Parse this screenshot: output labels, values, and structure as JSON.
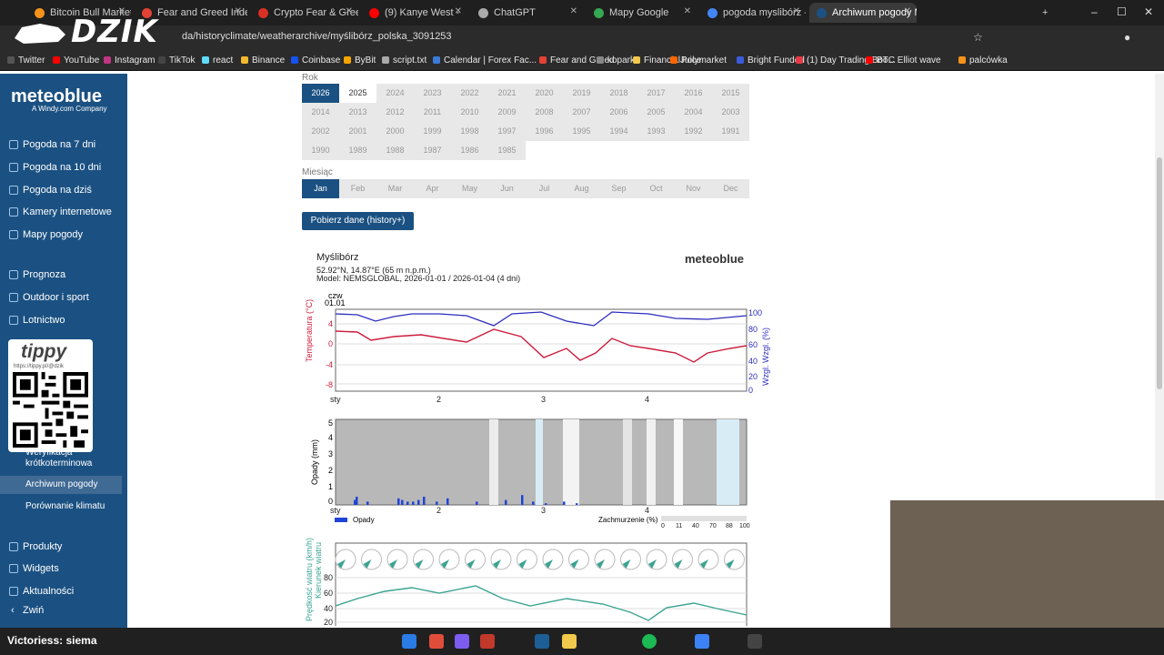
{
  "browser": {
    "tabs": [
      {
        "title": "Bitcoin Bull Market",
        "color": "#f7931a"
      },
      {
        "title": "Fear and Greed Index",
        "color": "#e34234"
      },
      {
        "title": "Crypto Fear & Greed",
        "color": "#d93025"
      },
      {
        "title": "(9) Kanye West -",
        "color": "#ff0000"
      },
      {
        "title": "ChatGPT",
        "color": "#aaaaaa"
      },
      {
        "title": "Mapy Google",
        "color": "#34a853"
      },
      {
        "title": "pogoda myslibórz - S",
        "color": "#4285f4"
      },
      {
        "title": "Archiwum pogody M",
        "color": "#1b5182"
      }
    ],
    "new_tab": "+",
    "url": "da/historyclimate/weatherarchive/myślibórz_polska_3091253",
    "bookmarks": [
      "Twitter",
      "YouTube",
      "Instagram",
      "TikTok",
      "react",
      "Binance",
      "Coinbase",
      "ByBit",
      "script.txt",
      "Calendar | Forex Fac...",
      "Fear and Greed",
      "koparka",
      "FinancialJuice",
      "Polymarket",
      "Bright Funded",
      "(1) Day Trading Boo...",
      "BTC Elliot wave",
      "palcówka"
    ]
  },
  "overlay": {
    "logo": "DZIK",
    "chat_user": "Victoriess",
    "chat_text": ": siema"
  },
  "sidebar": {
    "logo": "meteoblue",
    "logo_sub": "A Windy.com Company",
    "items": [
      "Pogoda na 7 dni",
      "Pogoda na 10 dni",
      "Pogoda na dziś",
      "Kamery internetowe",
      "Mapy pogody",
      "Prognoza",
      "Outdoor i sport",
      "Lotnictwo"
    ],
    "sub_items": [
      "Weryfikacja krótkoterminowa",
      "Archiwum pogody",
      "Porównanie klimatu"
    ],
    "bottom_items": [
      "Produkty",
      "Widgets",
      "Aktualności"
    ],
    "collapse": "Zwiń",
    "qr_title": "tippy",
    "qr_link": "https://tippy.pl/@dzik"
  },
  "filters": {
    "year_label": "Rok",
    "years": [
      "2026",
      "2025",
      "2024",
      "2023",
      "2022",
      "2021",
      "2020",
      "2019",
      "2018",
      "2017",
      "2016",
      "2015",
      "2014",
      "2013",
      "2012",
      "2011",
      "2010",
      "2009",
      "2008",
      "2007",
      "2006",
      "2005",
      "2004",
      "2003",
      "2002",
      "2001",
      "2000",
      "1999",
      "1998",
      "1997",
      "1996",
      "1995",
      "1994",
      "1993",
      "1992",
      "1991",
      "1990",
      "1989",
      "1988",
      "1987",
      "1986",
      "1985"
    ],
    "month_label": "Miesiąc",
    "months": [
      "Jan",
      "Feb",
      "Mar",
      "Apr",
      "May",
      "Jun",
      "Jul",
      "Aug",
      "Sep",
      "Oct",
      "Nov",
      "Dec"
    ],
    "download_button": "Pobierz dane (history+)"
  },
  "meteogram": {
    "location": "Myślibórz",
    "coords": "52.92°N, 14.87°E (65 m n.p.m.)",
    "model": "Model: NEMSGLOBAL, 2026-01-01 / 2026-01-04 (4 dni)",
    "brand": "meteoblue",
    "day_label_top": "czw",
    "date_label_top": "01.01",
    "x_labels": [
      "sty",
      "2",
      "3",
      "4"
    ],
    "temp_axis_label": "Temperatura (°C)",
    "temp_ticks": [
      "4",
      "0",
      "-4",
      "-8"
    ],
    "hum_axis_label": "Wzgl. Wzgl. (%)",
    "hum_ticks": [
      "100",
      "80",
      "60",
      "40",
      "20",
      "0"
    ],
    "precip_axis_label": "Opady (mm)",
    "precip_ticks": [
      "5",
      "4",
      "3",
      "2",
      "1",
      "0"
    ],
    "precip_legend": "Opady",
    "cloud_legend": "Zachmurzenie (%)",
    "cloud_ticks": [
      "0",
      "11",
      "40",
      "70",
      "88",
      "100"
    ],
    "wind_axis_label": "Prędkość wiatru (km/h)",
    "wind_dir_label": "Kierunek wiatru",
    "wind_ticks": [
      "80",
      "60",
      "40",
      "20"
    ]
  },
  "chart_data": [
    {
      "type": "line",
      "title": "",
      "x": [
        "sty",
        "2",
        "3",
        "4"
      ],
      "series": [
        {
          "name": "Temperatura (°C)",
          "values": [
            2,
            0,
            1,
            -1,
            -4,
            2,
            -2,
            -1,
            -6,
            -1
          ]
        },
        {
          "name": "Wzgl. Wzgl. (%)",
          "values": [
            100,
            95,
            98,
            98,
            90,
            97,
            88,
            98,
            96,
            98
          ]
        }
      ]
    },
    {
      "type": "bar",
      "title": "",
      "ylabel": "Opady (mm)",
      "ylim": [
        0,
        5
      ],
      "values": [
        0.3,
        0.5,
        0.2,
        0.4,
        0.3,
        0.2,
        0.2,
        0.3,
        0.5,
        0.2,
        0.4,
        0.2,
        0.3,
        0.6,
        0.2,
        0.1,
        0.2,
        0.1
      ]
    },
    {
      "type": "line",
      "title": "",
      "ylabel": "Prędkość wiatru (km/h)",
      "ylim": [
        20,
        80
      ],
      "values": [
        50,
        62,
        58,
        50,
        38,
        54,
        58,
        44,
        33,
        48,
        50,
        48,
        50
      ]
    }
  ]
}
